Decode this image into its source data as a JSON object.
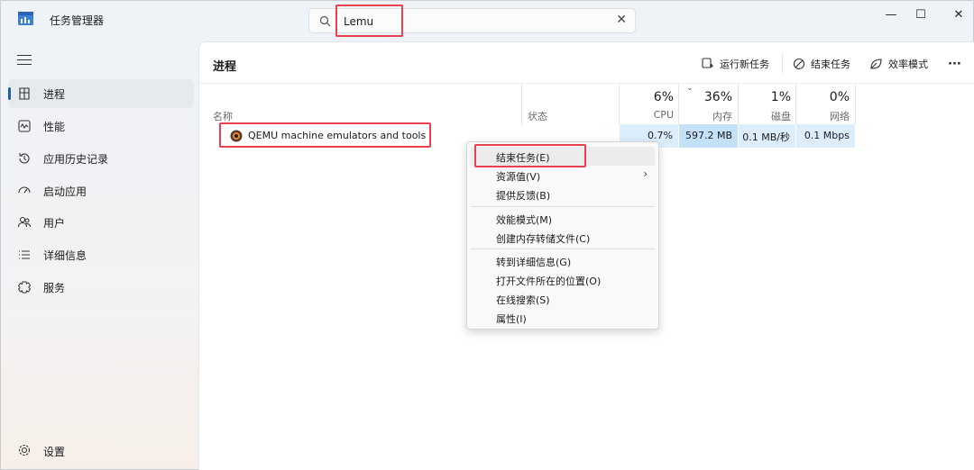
{
  "window": {
    "title": "任务管理器",
    "controls": {
      "minimize": "—",
      "maximize": "☐",
      "close": "✕"
    }
  },
  "search": {
    "value": "Lemu",
    "placeholder": "",
    "clear_icon": "✕"
  },
  "sidebar": {
    "items": [
      {
        "label": "进程",
        "icon": "processes-icon",
        "active": true
      },
      {
        "label": "性能",
        "icon": "performance-icon"
      },
      {
        "label": "应用历史记录",
        "icon": "history-icon"
      },
      {
        "label": "启动应用",
        "icon": "startup-icon"
      },
      {
        "label": "用户",
        "icon": "users-icon"
      },
      {
        "label": "详细信息",
        "icon": "details-icon"
      },
      {
        "label": "服务",
        "icon": "services-icon"
      }
    ],
    "settings_label": "设置"
  },
  "main": {
    "title": "进程",
    "toolbar": {
      "run_new_task": "运行新任务",
      "end_task": "结束任务",
      "efficiency_mode": "效率模式",
      "more": "···"
    },
    "columns": {
      "name": "名称",
      "status": "状态",
      "cpu": {
        "percent": "6%",
        "label": "CPU"
      },
      "memory": {
        "percent": "36%",
        "label": "内存"
      },
      "disk": {
        "percent": "1%",
        "label": "磁盘"
      },
      "network": {
        "percent": "0%",
        "label": "网络"
      }
    },
    "rows": [
      {
        "name": "QEMU machine emulators and tools",
        "status": "",
        "cpu": "0.7%",
        "memory": "597.2 MB",
        "disk": "0.1 MB/秒",
        "network": "0.1 Mbps"
      }
    ]
  },
  "context_menu": {
    "groups": [
      [
        {
          "label": "结束任务(E)"
        },
        {
          "label": "资源值(V)",
          "submenu_arrow": "›"
        },
        {
          "label": "提供反馈(B)"
        }
      ],
      [
        {
          "label": "效能模式(M)"
        },
        {
          "label": "创建内存转储文件(C)"
        }
      ],
      [
        {
          "label": "转到详细信息(G)"
        },
        {
          "label": "打开文件所在的位置(O)"
        },
        {
          "label": "在线搜索(S)"
        },
        {
          "label": "属性(I)"
        }
      ]
    ]
  },
  "colors": {
    "accent": "#1c5fb8",
    "highlight_border": "#e8404f",
    "cpu_cell": "#dceefc",
    "memory_cell": "#c4e1fa"
  }
}
